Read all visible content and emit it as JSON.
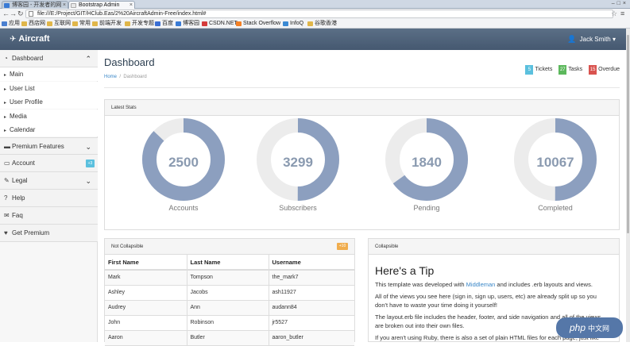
{
  "browser": {
    "tabs": [
      {
        "label": "博客园 - 开发者的网"
      },
      {
        "label": "Bootstrap Admin"
      }
    ],
    "url": "file:///E:/Project/GIT/HClub.Eas/2%20AircraftAdmin-Free/index.html#",
    "bookmarks": [
      "应用",
      "西店网",
      "互联网",
      "常用",
      "前端开发",
      "开发专题",
      "百度",
      "博客园",
      "CSDN.NET",
      "Stack Overflow",
      "InfoQ",
      "谷歌香港"
    ]
  },
  "app": {
    "brand": "Aircraft",
    "user": "Jack Smith"
  },
  "sidebar": {
    "dashboard": "Dashboard",
    "sub_items": [
      "Main",
      "User List",
      "User Profile",
      "Media",
      "Calendar"
    ],
    "premium_features": "Premium Features",
    "account": "Account",
    "account_badge": "+3",
    "legal": "Legal",
    "help": "Help",
    "faq": "Faq",
    "get_premium": "Get Premium"
  },
  "main": {
    "title": "Dashboard",
    "breadcrumb_home": "Home",
    "breadcrumb_sep": "/",
    "breadcrumb_current": "Dashboard",
    "top_stats": [
      {
        "count": "5",
        "label": "Tickets",
        "color": "#5bc0de"
      },
      {
        "count": "27",
        "label": "Tasks",
        "color": "#5cb85c"
      },
      {
        "count": "15",
        "label": "Overdue",
        "color": "#d9534f"
      }
    ]
  },
  "latest_stats": {
    "title": "Latest Stats",
    "gauges": [
      {
        "value": "2500",
        "label": "Accounts",
        "fill": 0.87
      },
      {
        "value": "3299",
        "label": "Subscribers",
        "fill": 0.5
      },
      {
        "value": "1840",
        "label": "Pending",
        "fill": 0.65
      },
      {
        "value": "10067",
        "label": "Completed",
        "fill": 0.5
      }
    ],
    "ring_color": "#8c9fbf",
    "track_color": "#ececec"
  },
  "not_collapsible": {
    "title": "Not Collapsible",
    "badge": "+10",
    "columns": [
      "First Name",
      "Last Name",
      "Username"
    ],
    "rows": [
      [
        "Mark",
        "Tompson",
        "the_mark7"
      ],
      [
        "Ashley",
        "Jacobs",
        "ash11927"
      ],
      [
        "Audrey",
        "Ann",
        "audann84"
      ],
      [
        "John",
        "Robinson",
        "jr5527"
      ],
      [
        "Aaron",
        "Butler",
        "aaron_butler"
      ]
    ]
  },
  "collapsible": {
    "title": "Collapsible",
    "tip_title": "Here's a Tip",
    "p1_before": "This template was developed with ",
    "p1_link": "Middleman",
    "p1_after": " and includes .erb layouts and views.",
    "p2": "All of the views you see here (sign in, sign up, users, etc) are already split up so you don't have to waste your time doing it yourself!",
    "p3": "The layout.erb file includes the header, footer, and side navigation and all of the views are broken out into their own files.",
    "p4": "If you aren't using Ruby, there is also a set of plain HTML files for each page, just like"
  },
  "watermark": {
    "text": "php",
    "sub": "中文网"
  }
}
